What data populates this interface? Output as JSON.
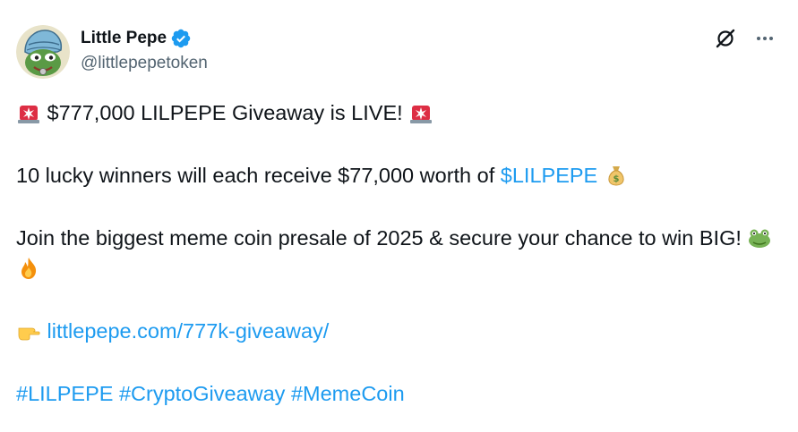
{
  "author": {
    "display_name": "Little Pepe",
    "handle": "@littlepepetoken"
  },
  "post": {
    "line1_text": "$777,000 LILPEPE Giveaway is LIVE!",
    "line2_text": "10 lucky winners will each receive $77,000 worth of ",
    "line2_cashtag": "$LILPEPE",
    "line3_text": "Join the biggest meme coin presale of 2025 & secure your chance to win BIG!",
    "link_url": "littlepepe.com/777k-giveaway/",
    "hashtags": [
      "#LILPEPE",
      "#CryptoGiveaway",
      "#MemeCoin"
    ]
  },
  "colors": {
    "link": "#1d9bf0",
    "text": "#0f1419",
    "secondary": "#536471",
    "verified": "#1d9bf0"
  },
  "icons": {
    "siren": "police-car-light-emoji",
    "money_bag": "money-bag-emoji",
    "frog": "frog-emoji",
    "fire": "fire-emoji",
    "point_right": "backhand-index-pointing-right-emoji"
  }
}
